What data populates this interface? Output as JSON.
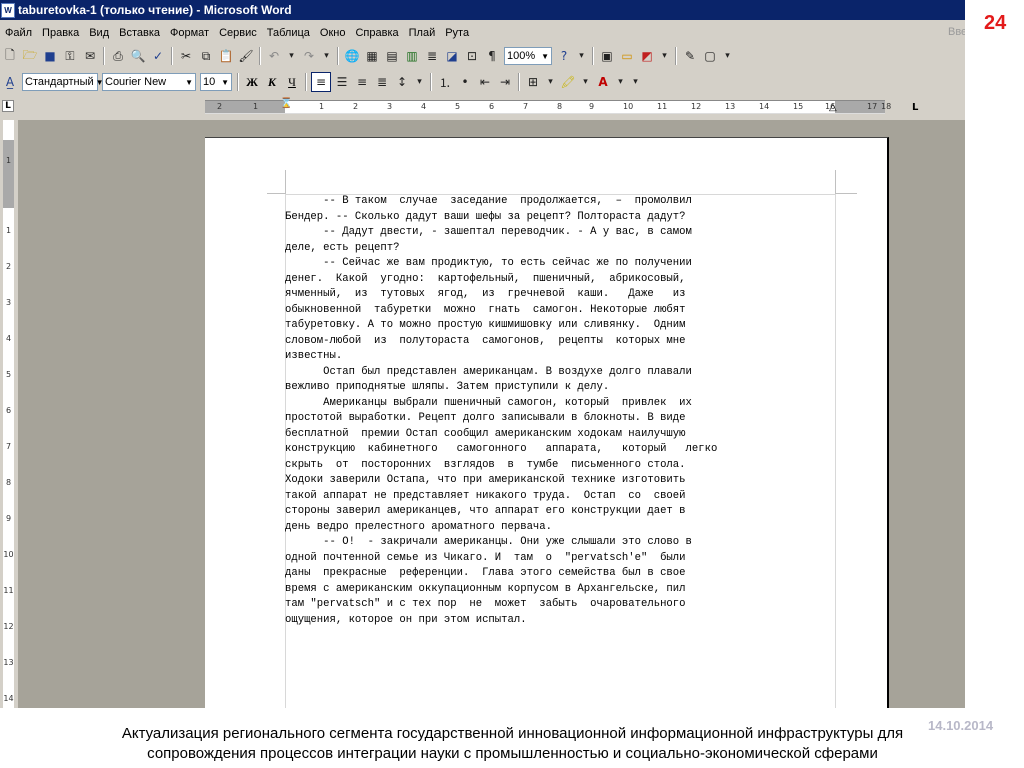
{
  "window": {
    "title": "taburetovka-1 (только чтение) - Microsoft Word",
    "icon": "word-doc-icon"
  },
  "menu": [
    "Файл",
    "Правка",
    "Вид",
    "Вставка",
    "Формат",
    "Сервис",
    "Таблица",
    "Окно",
    "Справка",
    "Плай",
    "Рута"
  ],
  "help_box_text": "Вве",
  "toolbar_standard": {
    "zoom": "100%",
    "icons": [
      "new-icon",
      "open-icon",
      "save-icon",
      "permission-icon",
      "email-icon",
      "print-icon",
      "print-preview-icon",
      "spelling-icon",
      "cut-icon",
      "copy-icon",
      "paste-icon",
      "format-painter-icon",
      "undo-icon",
      "redo-icon",
      "hyperlink-icon",
      "tables-borders-icon",
      "insert-table-icon",
      "insert-excel-icon",
      "columns-icon",
      "drawing-icon",
      "document-map-icon",
      "show-hide-icon",
      "help-icon",
      "reviewing-icon",
      "research-icon"
    ]
  },
  "toolbar_formatting": {
    "style": "Стандартный",
    "font": "Courier New",
    "size": "10",
    "bold_label": "Ж",
    "italic_label": "К",
    "underline_label": "Ч"
  },
  "ruler_numbers": [
    "2",
    "1",
    "1",
    "2",
    "3",
    "4",
    "5",
    "6",
    "7",
    "8",
    "9",
    "10",
    "11",
    "12",
    "13",
    "14",
    "15",
    "16",
    "17",
    "18"
  ],
  "vruler_numbers": [
    "1",
    "1",
    "2",
    "3",
    "4",
    "5",
    "6",
    "7",
    "8",
    "9",
    "10",
    "11",
    "12",
    "13",
    "14"
  ],
  "document": {
    "lines": [
      "      -- В таком  случае  заседание  продолжается,  –  промолвил",
      "Бендер. -- Сколько дадут ваши шефы за рецепт? Полтораста дадут?",
      "      -- Дадут двести, - зашептал переводчик. - А у вас, в самом",
      "деле, есть рецепт?",
      "      -- Сейчас же вам продиктую, то есть сейчас же по получении",
      "денег.  Какой  угодно:  картофельный,  пшеничный,  абрикосовый,",
      "ячменный,  из  тутовых  ягод,  из  гречневой  каши.   Даже   из",
      "обыкновенной  табуретки  можно  гнать  самогон. Некоторые любят",
      "табуретовку. А то можно простую кишмишовку или сливянку.  Одним",
      "словом-любой  из  полутораста  самогонов,  рецепты  которых мне",
      "известны.",
      "      Остап был представлен американцам. В воздухе долго плавали",
      "вежливо приподнятые шляпы. Затем приступили к делу.",
      "      Американцы выбрали пшеничный самогон, который  привлек  их",
      "простотой выработки. Рецепт долго записывали в блокноты. В виде",
      "бесплатной  премии Остап сообщил американским ходокам наилучшую",
      "конструкцию  кабинетного   самогонного   аппарата,   который   легко",
      "скрыть  от  посторонних  взглядов  в  тумбе  письменного стола.",
      "Ходоки заверили Остапа, что при американской технике изготовить",
      "такой аппарат не представляет никакого труда.  Остап  со  своей",
      "стороны заверил американцев, что аппарат его конструкции дает в",
      "день ведро прелестного ароматного первача.",
      "      -- О!  - закричали американцы. Они уже слышали это слово в",
      "одной почтенной семье из Чикаго. И  там  о  \"pervatsch'e\"  были",
      "даны  прекрасные  референции.  Глава этого семейства был в свое",
      "время с американским оккупационным корпусом в Архангельске, пил",
      "там \"pervatsch\" и с тех пор  не  может  забыть  очаровательного",
      "ощущения, которое он при этом испытал."
    ]
  },
  "slide": {
    "number": "24",
    "date": "14.10.2014",
    "caption_line1": "Актуализация регионального сегмента государственной инновационной информационной инфраструктуры для",
    "caption_line2": "сопровождения процессов интеграции науки с промышленностью и социально-экономической сферами"
  },
  "colors": {
    "titlebar": "#0a246a",
    "slide_number": "#e31a1a",
    "workspace": "#a6a399"
  }
}
